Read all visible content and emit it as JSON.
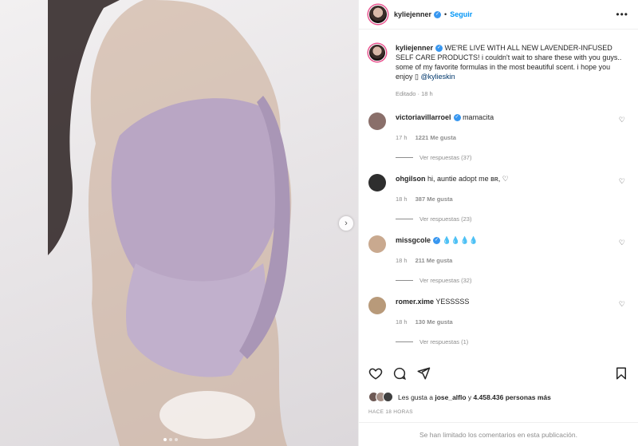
{
  "post": {
    "username": "kyliejenner",
    "follow_label": "Seguir",
    "separator": "•",
    "more_label": "•••"
  },
  "caption": {
    "username": "kyliejenner",
    "text": "WE'RE LIVE WITH ALL NEW LAVENDER-INFUSED SELF CARE PRODUCTS! i couldn't wait to share these with you guys.. some of my favorite formulas in the most beautiful scent. i hope you enjoy",
    "emoji": "▯",
    "mention": "@kylieskin",
    "edited": "Editado · 18 h"
  },
  "comments": [
    {
      "username": "victoriavillarroel",
      "verified": true,
      "text": "mamacita",
      "time": "17 h",
      "likes": "1221 Me gusta",
      "replies": "Ver respuestas (37)",
      "avatar_color": "#8a6f6a"
    },
    {
      "username": "ohgilson",
      "verified": false,
      "text": "hi, auntie adopt me ʙʀ, ♡",
      "time": "18 h",
      "likes": "387 Me gusta",
      "replies": "Ver respuestas (23)",
      "avatar_color": "#2e2e2e"
    },
    {
      "username": "missgcole",
      "verified": true,
      "text": "💧💧💧💧",
      "time": "18 h",
      "likes": "211 Me gusta",
      "replies": "Ver respuestas (32)",
      "avatar_color": "#c9a98f"
    },
    {
      "username": "romer.xime",
      "verified": false,
      "text": "YESSSSS",
      "time": "18 h",
      "likes": "130 Me gusta",
      "replies": "Ver respuestas (1)",
      "avatar_color": "#b89a7a"
    }
  ],
  "likes": {
    "prefix": "Les gusta a",
    "user": "jose_alflo",
    "suffix": "y",
    "count": "4.458.436 personas más"
  },
  "timestamp": "HACE 18 HORAS",
  "comments_limited": "Se han limitado los comentarios en esta publicación.",
  "carousel": {
    "slides": 3,
    "active_index": 0
  },
  "icons": {
    "next": "chevron-right-icon",
    "like": "heart-icon",
    "comment": "comment-icon",
    "share": "send-icon",
    "save": "bookmark-icon"
  },
  "colors": {
    "accent": "#0095f6",
    "verified": "#3897f0",
    "muted": "#8e8e8e",
    "text": "#262626"
  }
}
